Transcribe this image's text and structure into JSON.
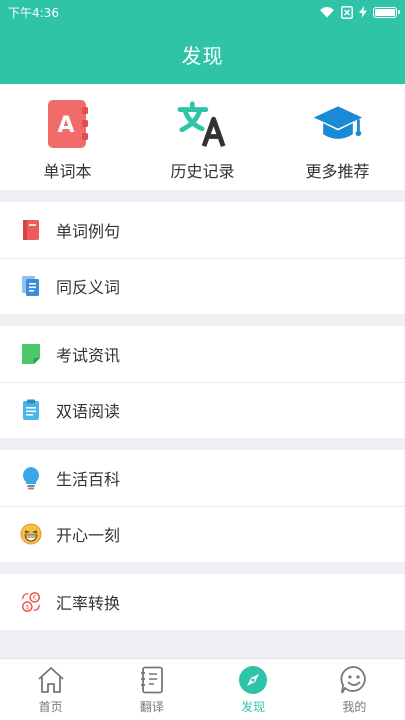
{
  "status_bar": {
    "time": "下午4:36",
    "icons": [
      "wifi-icon",
      "no-sim-icon",
      "charging-icon",
      "battery-icon"
    ]
  },
  "header": {
    "title": "发现"
  },
  "quick_actions": [
    {
      "label": "单词本",
      "icon": "wordbook-icon",
      "color": "#f26b6b"
    },
    {
      "label": "历史记录",
      "icon": "translate-icon",
      "color": "#2fc4a8"
    },
    {
      "label": "更多推荐",
      "icon": "graduation-cap-icon",
      "color": "#1a8ad4"
    }
  ],
  "groups": [
    {
      "items": [
        {
          "label": "单词例句",
          "icon": "red-book-icon",
          "color": "#ef5a5a"
        },
        {
          "label": "同反义词",
          "icon": "documents-icon",
          "color": "#3a8fd8"
        }
      ]
    },
    {
      "items": [
        {
          "label": "考试资讯",
          "icon": "green-note-icon",
          "color": "#4cc86a"
        },
        {
          "label": "双语阅读",
          "icon": "clipboard-icon",
          "color": "#4ab5e8"
        }
      ]
    },
    {
      "items": [
        {
          "label": "生活百科",
          "icon": "lightbulb-icon",
          "color": "#3aa8e6"
        },
        {
          "label": "开心一刻",
          "icon": "laughing-face-icon",
          "color": "#f5a623"
        }
      ]
    },
    {
      "items": [
        {
          "label": "汇率转换",
          "icon": "currency-exchange-icon",
          "color": "#e85a4f"
        }
      ]
    }
  ],
  "tabs": [
    {
      "label": "首页",
      "icon": "home-icon",
      "active": false
    },
    {
      "label": "翻译",
      "icon": "notebook-icon",
      "active": false
    },
    {
      "label": "发现",
      "icon": "compass-icon",
      "active": true
    },
    {
      "label": "我的",
      "icon": "profile-face-icon",
      "active": false
    }
  ],
  "colors": {
    "accent": "#2fc4a8",
    "background": "#f0eff4"
  }
}
